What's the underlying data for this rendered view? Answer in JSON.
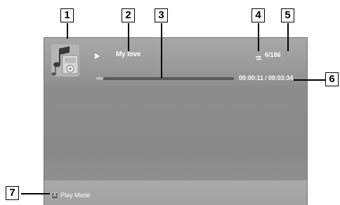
{
  "player": {
    "song_title": "My love",
    "track_count": "6/186",
    "elapsed": "00:00:11",
    "separator": "/",
    "total": "00:03:34",
    "time_readout": "00:00:11 / 00:03:34",
    "progress_fraction": 0.05,
    "repeat_icon": "repeat-icon",
    "play_icon": "play-icon",
    "album_art_icon": "music-note-icon"
  },
  "footer": {
    "button_key": "A",
    "play_mode_label": "Play Mode"
  },
  "callouts": [
    "1",
    "2",
    "3",
    "4",
    "5",
    "6",
    "7"
  ]
}
